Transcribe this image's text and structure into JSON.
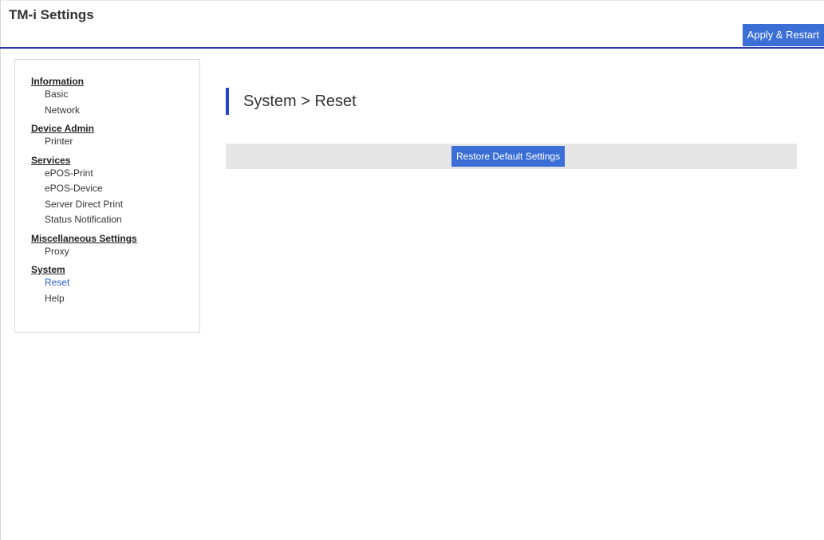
{
  "header": {
    "title": "TM-i Settings",
    "apply_label": "Apply & Restart"
  },
  "sidebar": {
    "groups": [
      {
        "heading": "Information",
        "items": [
          "Basic",
          "Network"
        ]
      },
      {
        "heading": "Device Admin",
        "items": [
          "Printer"
        ]
      },
      {
        "heading": "Services",
        "items": [
          "ePOS-Print",
          "ePOS-Device",
          "Server Direct Print",
          "Status Notification"
        ]
      },
      {
        "heading": "Miscellaneous Settings",
        "items": [
          "Proxy"
        ]
      },
      {
        "heading": "System",
        "items": [
          "Reset",
          "Help"
        ]
      }
    ],
    "active_item": "Reset"
  },
  "main": {
    "title": "System > Reset",
    "restore_label": "Restore Default Settings"
  },
  "colors": {
    "accent": "#3b6fd6",
    "header_rule": "#2b3aa8",
    "active_link": "#2a5bd7",
    "action_bar_bg": "#e6e6e6"
  }
}
